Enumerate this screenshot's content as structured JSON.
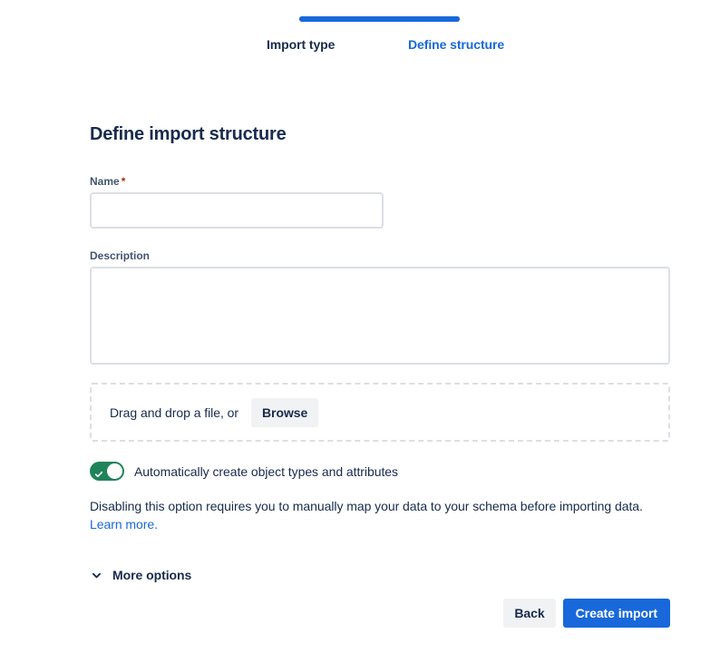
{
  "stepper": {
    "progress_percent": 100,
    "steps": [
      {
        "label": "Import type",
        "state": "inactive"
      },
      {
        "label": "Define structure",
        "state": "active"
      }
    ],
    "active_color": "#1868DB",
    "inactive_color": "#172B4D"
  },
  "form": {
    "title": "Define import structure",
    "name_field": {
      "label": "Name",
      "required_marker": "*",
      "value": "",
      "placeholder": ""
    },
    "description_field": {
      "label": "Description",
      "value": "",
      "placeholder": ""
    },
    "dropzone": {
      "text": "Drag and drop a file, or",
      "browse_label": "Browse"
    },
    "auto_create_toggle": {
      "label": "Automatically create object types and attributes",
      "state": "on",
      "on_color": "#1F845A",
      "icon": "check-icon"
    },
    "helper": {
      "text": "Disabling this option requires you to manually map your data to your schema before importing data. ",
      "link_text": "Learn more.",
      "link_color": "#1868DB"
    },
    "more_options": {
      "label": "More options",
      "icon": "chevron-down-icon",
      "expanded": false
    }
  },
  "footer": {
    "back_label": "Back",
    "create_label": "Create import",
    "primary_color": "#1868DB"
  }
}
